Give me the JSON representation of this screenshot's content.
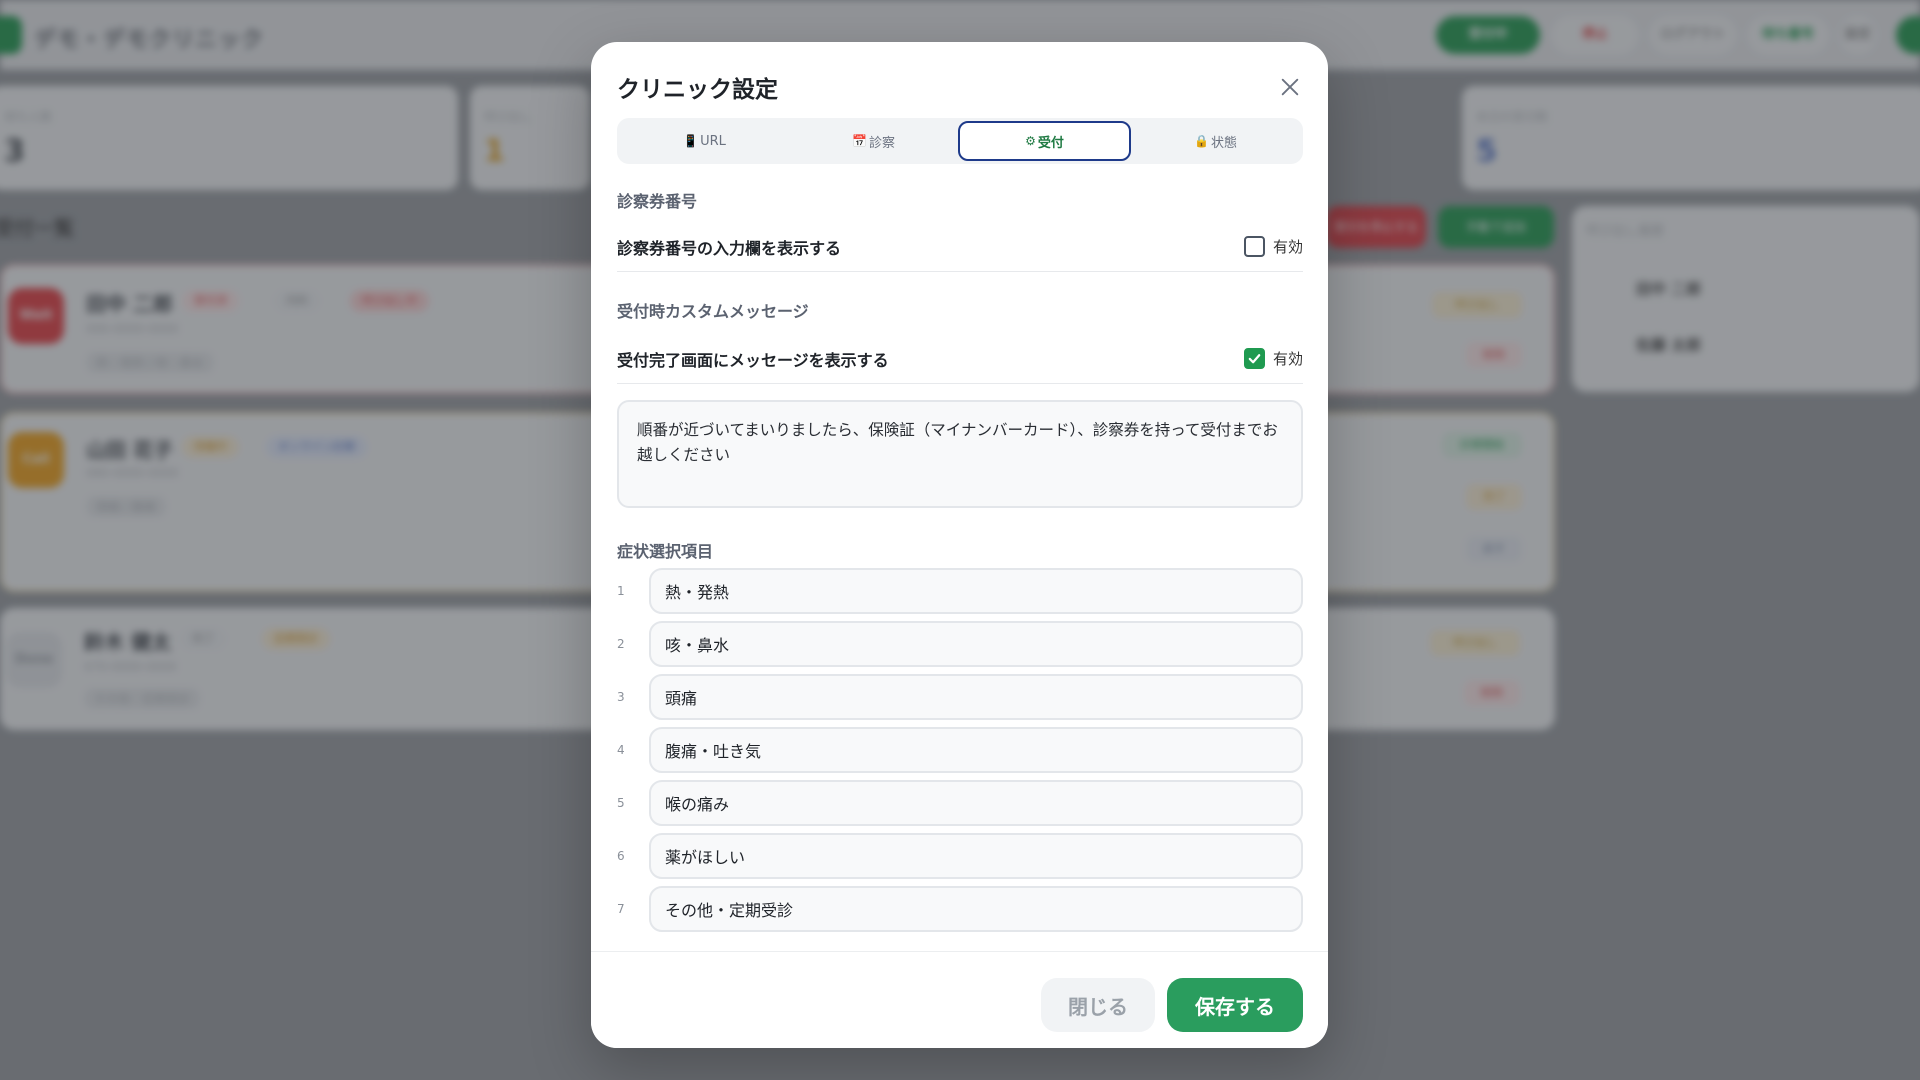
{
  "background": {
    "app_name": "デモ・デモクリニック",
    "header_pills": [
      "受付中",
      "停止",
      "ログアウト",
      "待ち番号",
      "設定"
    ],
    "stats": [
      {
        "label": "待ち人数",
        "value": "3"
      },
      {
        "label": "呼び出し",
        "value": "1"
      },
      {
        "label": "本日の受付数",
        "value": "5"
      }
    ],
    "section_title": "受付一覧",
    "buttons": [
      "受付を停止する",
      "手動で追加"
    ],
    "patients": [
      {
        "avatar": "Wait",
        "name": "田中 二郎",
        "tags": [
          "受付済",
          "内科",
          "呼び出し中"
        ],
        "sub": "090-0000-0000",
        "note": "熱・発熱 / 咳・鼻水",
        "badges": [
          "呼び出し",
          "削除"
        ]
      },
      {
        "avatar": "Call",
        "name": "山田 花子",
        "tags": [
          "待機中",
          "オンライン診察"
        ],
        "sub": "080-0000-0000",
        "note": "頭痛 / 腹痛",
        "badges": [
          "診察開始",
          "完了",
          "戻す"
        ]
      },
      {
        "avatar": "Done",
        "name": "鈴木 健太",
        "tags": [
          "完了",
          "定期受診"
        ],
        "sub": "070-0000-0000",
        "note": "その他・定期受診",
        "badges": [
          "呼び出し",
          "削除"
        ]
      }
    ],
    "side_panel": {
      "title": "呼び出し履歴",
      "rows": [
        "田中 二郎",
        "佐藤 太郎"
      ]
    }
  },
  "modal": {
    "title": "クリニック設定",
    "close_icon": "close-icon",
    "tabs": [
      {
        "icon": "📱",
        "label": "URL",
        "active": false
      },
      {
        "icon": "📅",
        "label": "診察",
        "active": false
      },
      {
        "icon": "⚙",
        "label": "受付",
        "active": true
      },
      {
        "icon": "🔒",
        "label": "状態",
        "active": false
      }
    ],
    "ticket_section": {
      "heading": "診察券番号",
      "setting_label": "診察券番号の入力欄を表示する",
      "checkbox_label": "有効",
      "checked": false
    },
    "message_section": {
      "heading": "受付時カスタムメッセージ",
      "setting_label": "受付完了画面にメッセージを表示する",
      "checkbox_label": "有効",
      "checked": true,
      "message": "順番が近づいてまいりましたら、保険証（マイナンバーカード）、診察券を持って受付までお越しください"
    },
    "symptom_section": {
      "heading": "症状選択項目",
      "items": [
        {
          "num": "1",
          "value": "熱・発熱"
        },
        {
          "num": "2",
          "value": "咳・鼻水"
        },
        {
          "num": "3",
          "value": "頭痛"
        },
        {
          "num": "4",
          "value": "腹痛・吐き気"
        },
        {
          "num": "5",
          "value": "喉の痛み"
        },
        {
          "num": "6",
          "value": "薬がほしい"
        },
        {
          "num": "7",
          "value": "その他・定期受診"
        }
      ]
    },
    "footer": {
      "close_label": "閉じる",
      "save_label": "保存する"
    }
  },
  "colors": {
    "accent_green": "#2a9d5e",
    "active_tab_border": "#1e3a8a",
    "check_green": "#1f9a50"
  }
}
